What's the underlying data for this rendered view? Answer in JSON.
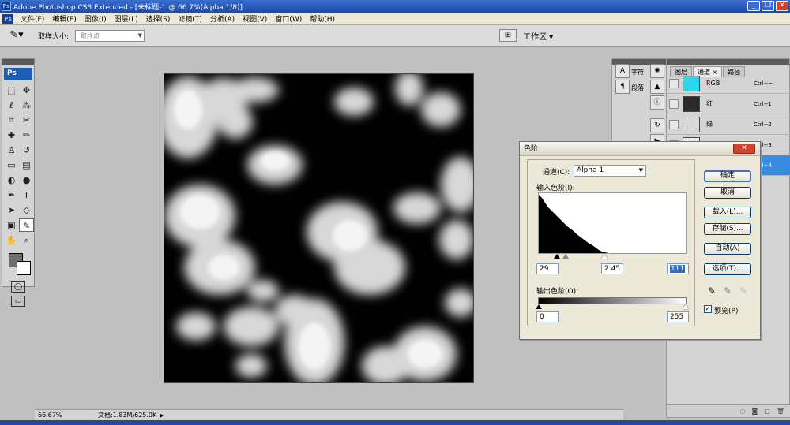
{
  "window": {
    "app_badge": "Ps",
    "title": "Adobe Photoshop CS3 Extended - [未标题-1 @ 66.7%(Alpha 1/8)]",
    "min": "_",
    "restore": "❐",
    "close": "✕"
  },
  "menu": {
    "items": [
      "文件(F)",
      "编辑(E)",
      "图像(I)",
      "图层(L)",
      "选择(S)",
      "滤镜(T)",
      "分析(A)",
      "视图(V)",
      "窗口(W)",
      "帮助(H)"
    ]
  },
  "options": {
    "sample_size_label": "取样大小:",
    "sample_size_value": "取样点",
    "workspace_label": "工作区 ▾"
  },
  "toolbox": {
    "logo": "Ps"
  },
  "status": {
    "zoom": "66.67%",
    "doc_info": "文档:1.83M/625.0K"
  },
  "dock": {
    "char_label": "字符",
    "para_label": "段落"
  },
  "channels_panel": {
    "tabs": [
      "图层",
      "通道 ×",
      "路径"
    ],
    "rows": [
      {
        "name": "RGB",
        "shortcut": "Ctrl+~",
        "color": "#29d6ec"
      },
      {
        "name": "红",
        "shortcut": "Ctrl+1",
        "color": "#2a2a2a"
      },
      {
        "name": "绿",
        "shortcut": "Ctrl+2",
        "color": "#d8d8d8"
      },
      {
        "name": "",
        "shortcut": "Ctrl+3",
        "color": "#ededed"
      },
      {
        "name": "",
        "shortcut": "Ctrl+4",
        "color": "#111111"
      }
    ]
  },
  "levels_dialog": {
    "title": "色阶",
    "channel_label": "通道(C):",
    "channel_value": "Alpha 1",
    "input_label": "输入色阶(I):",
    "input_black": "29",
    "input_gamma": "2.45",
    "input_white": "111",
    "output_label": "输出色阶(O):",
    "output_black": "0",
    "output_white": "255",
    "buttons": {
      "ok": "确定",
      "cancel": "取消",
      "load": "载入(L)...",
      "save": "存储(S)...",
      "auto": "自动(A)",
      "options": "选项(T)..."
    },
    "preview_label": "预览(P)",
    "preview_checked": true
  }
}
